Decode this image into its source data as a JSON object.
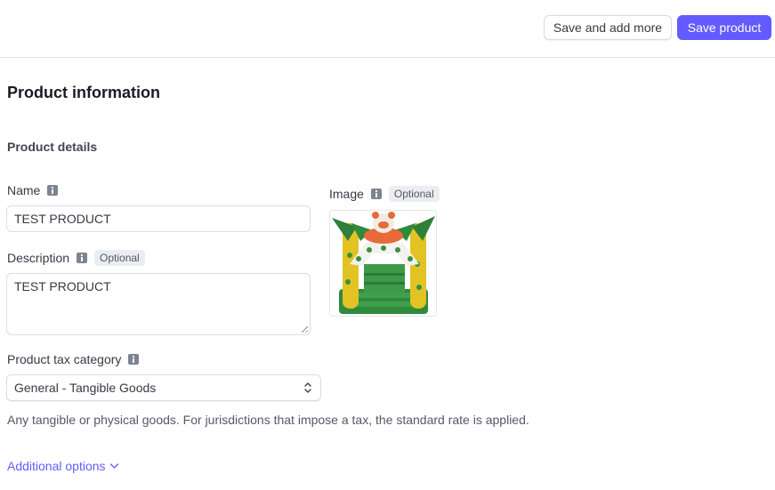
{
  "header": {
    "save_and_add_more_label": "Save and add more",
    "save_product_label": "Save product"
  },
  "page": {
    "title": "Product information",
    "section_title": "Product details"
  },
  "form": {
    "name": {
      "label": "Name",
      "value": "TEST PRODUCT",
      "info_icon": "info-icon"
    },
    "description": {
      "label": "Description",
      "badge": "Optional",
      "value": "TEST PRODUCT",
      "info_icon": "info-icon"
    },
    "image": {
      "label": "Image",
      "badge": "Optional",
      "alt": "Green and yellow inflatable bounce house with a tiger head",
      "info_icon": "info-icon"
    },
    "tax_category": {
      "label": "Product tax category",
      "selected": "General - Tangible Goods",
      "help_text": "Any tangible or physical goods. For jurisdictions that impose a tax, the standard rate is applied.",
      "info_icon": "info-icon"
    }
  },
  "additional_options": {
    "label": "Additional options",
    "icon": "chevron-down-icon"
  },
  "colors": {
    "accent": "#635bff",
    "border": "#d8dde3",
    "badge_bg": "#ebeef1"
  }
}
